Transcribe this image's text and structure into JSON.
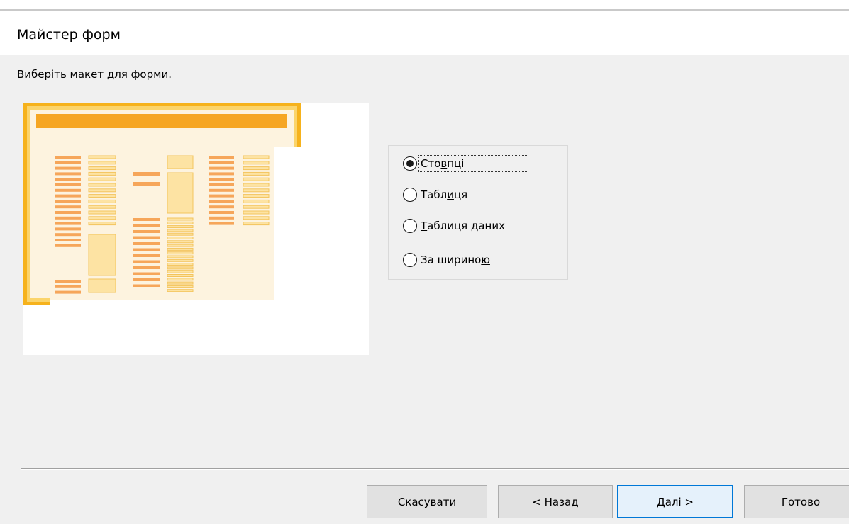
{
  "window": {
    "title": "Майстер форм"
  },
  "instruction": "Виберіть макет для форми.",
  "layout_options": [
    {
      "label": "Стовпці",
      "mnemonic_index": 3,
      "selected": true
    },
    {
      "label": "Таблиця",
      "mnemonic_index": 4,
      "selected": false
    },
    {
      "label": "Таблиця даних",
      "mnemonic_index": 0,
      "selected": false
    },
    {
      "label": "За шириною",
      "mnemonic_index": 9,
      "selected": false
    }
  ],
  "buttons": {
    "cancel": "Скасувати",
    "back": "< Назад",
    "next": "Далі >",
    "finish": "Готово"
  },
  "colors": {
    "preview_border": "#f3b21a",
    "preview_header": "#f6a623",
    "preview_paper": "#fdf4e3",
    "field_label": "#f6a65a",
    "field_box": "#fde3a3",
    "focus_button_border": "#0078d7"
  }
}
